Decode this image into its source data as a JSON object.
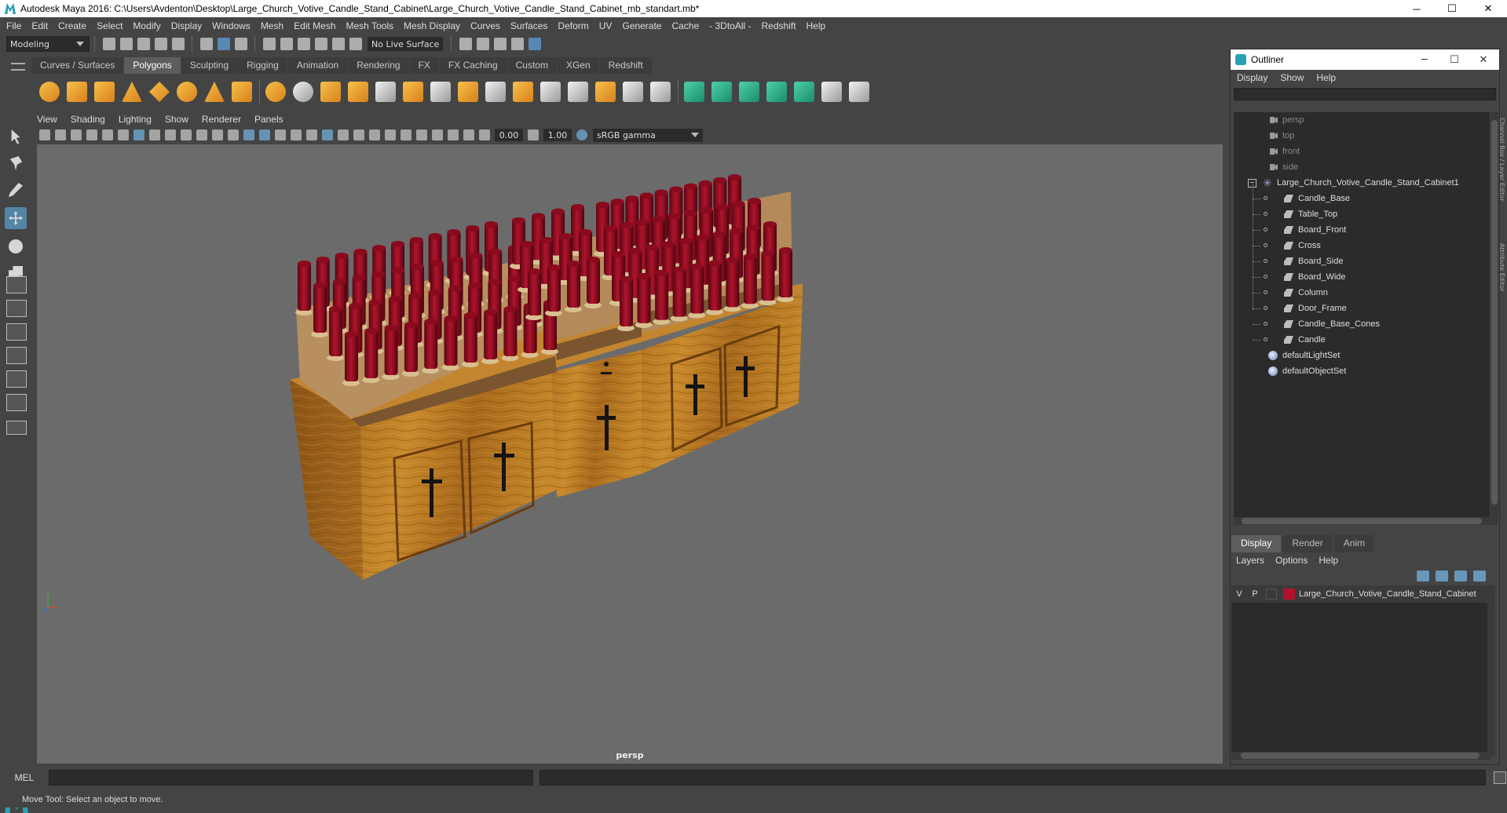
{
  "window": {
    "title": "Autodesk Maya 2016: C:\\Users\\Avdenton\\Desktop\\Large_Church_Votive_Candle_Stand_Cabinet\\Large_Church_Votive_Candle_Stand_Cabinet_mb_standart.mb*",
    "minimize": "─",
    "maximize": "☐",
    "close": "✕"
  },
  "menubar": [
    "File",
    "Edit",
    "Create",
    "Select",
    "Modify",
    "Display",
    "Windows",
    "Mesh",
    "Edit Mesh",
    "Mesh Tools",
    "Mesh Display",
    "Curves",
    "Surfaces",
    "Deform",
    "UV",
    "Generate",
    "Cache",
    "- 3DtoAll -",
    "Redshift",
    "Help"
  ],
  "statusline": {
    "mode": "Modeling",
    "live_surface": "No Live Surface"
  },
  "shelf": {
    "tabs": [
      "Curves / Surfaces",
      "Polygons",
      "Sculpting",
      "Rigging",
      "Animation",
      "Rendering",
      "FX",
      "FX Caching",
      "Custom",
      "XGen",
      "Redshift"
    ],
    "active_tab": "Polygons"
  },
  "viewport": {
    "menu": [
      "View",
      "Shading",
      "Lighting",
      "Show",
      "Renderer",
      "Panels"
    ],
    "exposure": "0.00",
    "gamma": "1.00",
    "color_space": "sRGB gamma",
    "camera_label": "persp"
  },
  "outliner": {
    "title": "Outliner",
    "menu": [
      "Display",
      "Show",
      "Help"
    ],
    "cameras": [
      "persp",
      "top",
      "front",
      "side"
    ],
    "group": "Large_Church_Votive_Candle_Stand_Cabinet1",
    "children": [
      "Candle_Base",
      "Table_Top",
      "Board_Front",
      "Cross",
      "Board_Side",
      "Board_Wide",
      "Column",
      "Door_Frame",
      "Candle_Base_Cones",
      "Candle"
    ],
    "sets": [
      "defaultLightSet",
      "defaultObjectSet"
    ]
  },
  "side_tabs": [
    "Channel Box / Layer Editor",
    "Attribute Editor"
  ],
  "layer_editor": {
    "tabs": [
      "Display",
      "Render",
      "Anim"
    ],
    "active_tab": "Display",
    "menu": [
      "Layers",
      "Options",
      "Help"
    ],
    "layer": {
      "visible": "V",
      "playback": "P",
      "name": "Large_Church_Votive_Candle_Stand_Cabinet",
      "color": "#b0142c"
    }
  },
  "command_line": {
    "label": "MEL"
  },
  "help_line": "Move Tool: Select an object to move."
}
